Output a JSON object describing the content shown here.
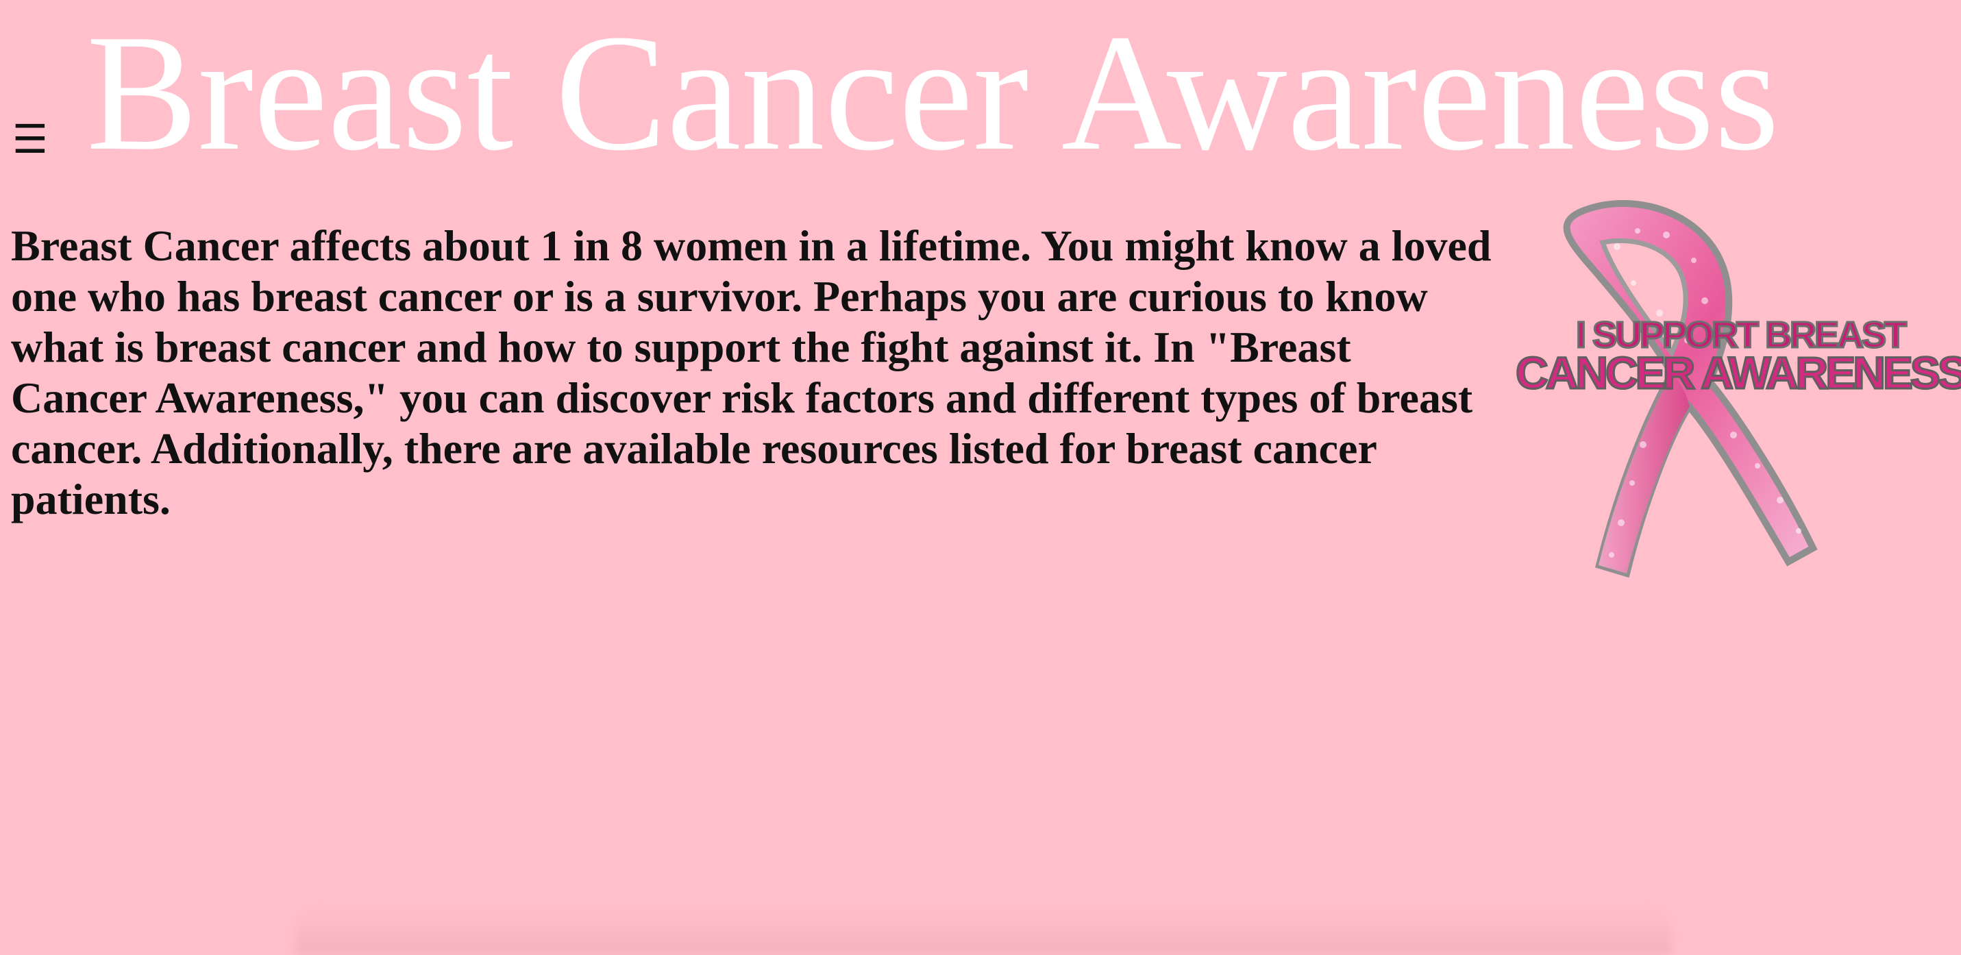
{
  "header": {
    "menu_icon": "☰",
    "title": "Breast Cancer Awareness"
  },
  "main": {
    "intro_text": "Breast Cancer affects about 1 in 8 women in a lifetime. You might know a loved one who has breast cancer or is a survivor. Perhaps you are curious to know what is breast cancer and how to support the fight against it. In \"Breast Cancer Awareness,\" you can discover risk factors and different types of breast cancer. Additionally, there are available resources listed for breast cancer patients."
  },
  "image": {
    "ribbon_text_line1": "I SUPPORT BREAST",
    "ribbon_text_line2": "CANCER AWARENESS"
  },
  "colors": {
    "background": "#ffc0cb",
    "title": "#ffffff",
    "text": "#111111",
    "ribbon": "#e85a9a"
  }
}
